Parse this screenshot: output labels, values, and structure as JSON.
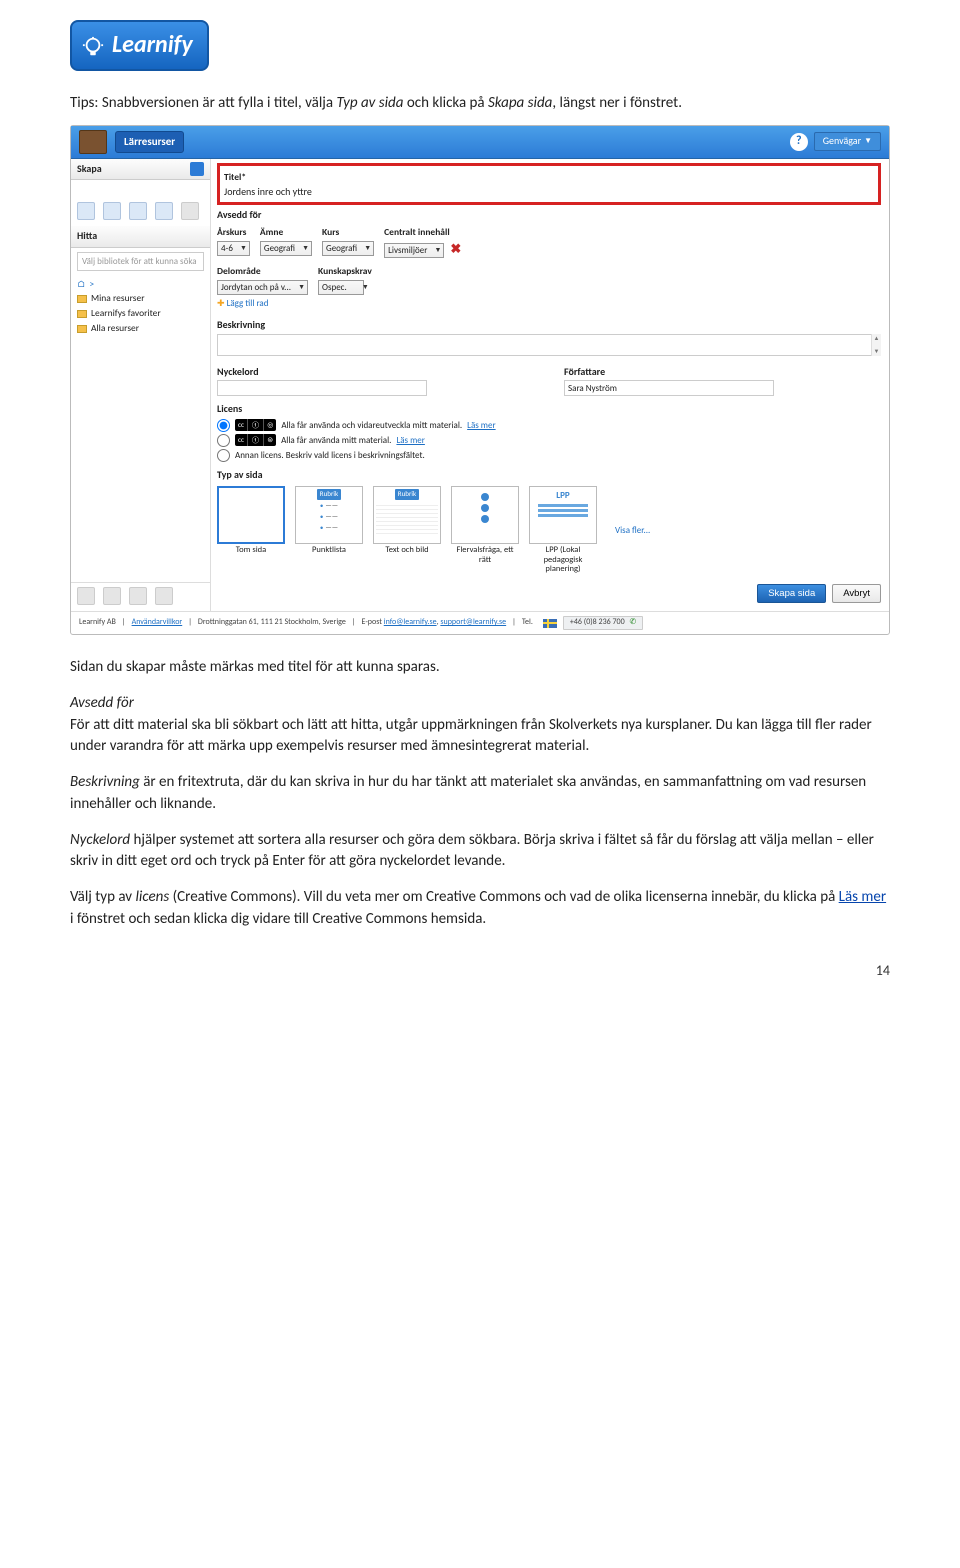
{
  "brand": "Learnify",
  "intro": {
    "prefix": "Tips: Snabbversionen är att fylla i titel, välja ",
    "ital1": "Typ av sida",
    "mid": " och klicka på ",
    "ital2": "Skapa sida",
    "suffix": ", längst ner i fönstret."
  },
  "app": {
    "topbar": {
      "title": "Lärresurser",
      "help": "?",
      "shortcuts": "Genvägar"
    },
    "leftcol": {
      "skapa": "Skapa",
      "hitta": "Hitta",
      "search_placeholder": "Välj bibliotek för att kunna söka",
      "root": ">",
      "items": [
        "Mina resurser",
        "Learnifys favoriter",
        "Alla resurser"
      ]
    },
    "titleField": {
      "label": "Titel*",
      "value": "Jordens inre och yttre"
    },
    "avsedd": {
      "heading": "Avsedd för",
      "fields": {
        "arskurs": {
          "label": "Årskurs",
          "value": "4-6"
        },
        "amne": {
          "label": "Ämne",
          "value": "Geografi"
        },
        "kurs": {
          "label": "Kurs",
          "value": "Geografi"
        },
        "centralt": {
          "label": "Centralt innehåll",
          "value": "Livsmiljöer"
        },
        "delomrade": {
          "label": "Delområde",
          "value": "Jordytan och på v..."
        },
        "kunskap": {
          "label": "Kunskapskrav",
          "value": "Ospec."
        }
      },
      "addRow": "Lägg till rad"
    },
    "beskrivning": {
      "label": "Beskrivning"
    },
    "nyckelord": {
      "label": "Nyckelord"
    },
    "forfattare": {
      "label": "Författare",
      "value": "Sara Nyström"
    },
    "licens": {
      "label": "Licens",
      "row1": "Alla får använda och vidareutveckla mitt material.",
      "row2": "Alla får använda mitt material.",
      "row3": "Annan licens. Beskriv vald licens i beskrivningsfältet.",
      "lasmer": "Läs mer"
    },
    "typ": {
      "label": "Typ av sida",
      "tiles": [
        {
          "caption": "Tom sida"
        },
        {
          "caption": "Punktlista",
          "header": "Rubrik"
        },
        {
          "caption": "Text och bild",
          "header": "Rubrik"
        },
        {
          "caption": "Flervalsfråga, ett rätt"
        },
        {
          "caption": "LPP (Lokal pedagogisk planering)",
          "header": "LPP"
        }
      ],
      "visafler": "Visa fler..."
    },
    "buttons": {
      "primary": "Skapa sida",
      "cancel": "Avbryt"
    },
    "footer": {
      "company": "Learnify AB",
      "terms": "Användarvillkor",
      "address": "Drottninggatan 61, 111 21 Stockholm, Sverige",
      "email_prefix": "E-post ",
      "email1": "info@learnify.se",
      "email2": "support@learnify.se",
      "tel_label": "Tel.",
      "tel": "+46 (0)8 236 700"
    }
  },
  "body": {
    "p1": "Sidan du skapar måste märkas med titel för att kunna sparas.",
    "avsedd_head": "Avsedd för",
    "p2": "För att ditt material ska bli sökbart och lätt att hitta, utgår uppmärkningen från Skolverkets nya kursplaner. Du kan lägga till fler rader under varandra för att märka upp exempelvis resurser med ämnesintegrerat material.",
    "p3_ital": "Beskrivning",
    "p3_rest": " är en fritextruta, där du kan skriva in hur du har tänkt att materialet ska användas, en sammanfattning om vad resursen innehåller och liknande.",
    "p4_ital": "Nyckelord",
    "p4_rest": " hjälper systemet att sortera alla resurser och göra dem sökbara. Börja skriva i fältet så får du förslag att välja mellan – eller skriv in ditt eget ord och tryck på Enter för att göra nyckelordet levande.",
    "p5_pre": "Välj typ av ",
    "p5_ital": "licens",
    "p5_mid": " (Creative Commons). Vill du veta mer om Creative Commons och vad de olika licenserna innebär, du klicka på ",
    "p5_link": "Läs mer",
    "p5_suf": " i fönstret och sedan klicka dig vidare till Creative Commons hemsida."
  },
  "pageNumber": "14"
}
